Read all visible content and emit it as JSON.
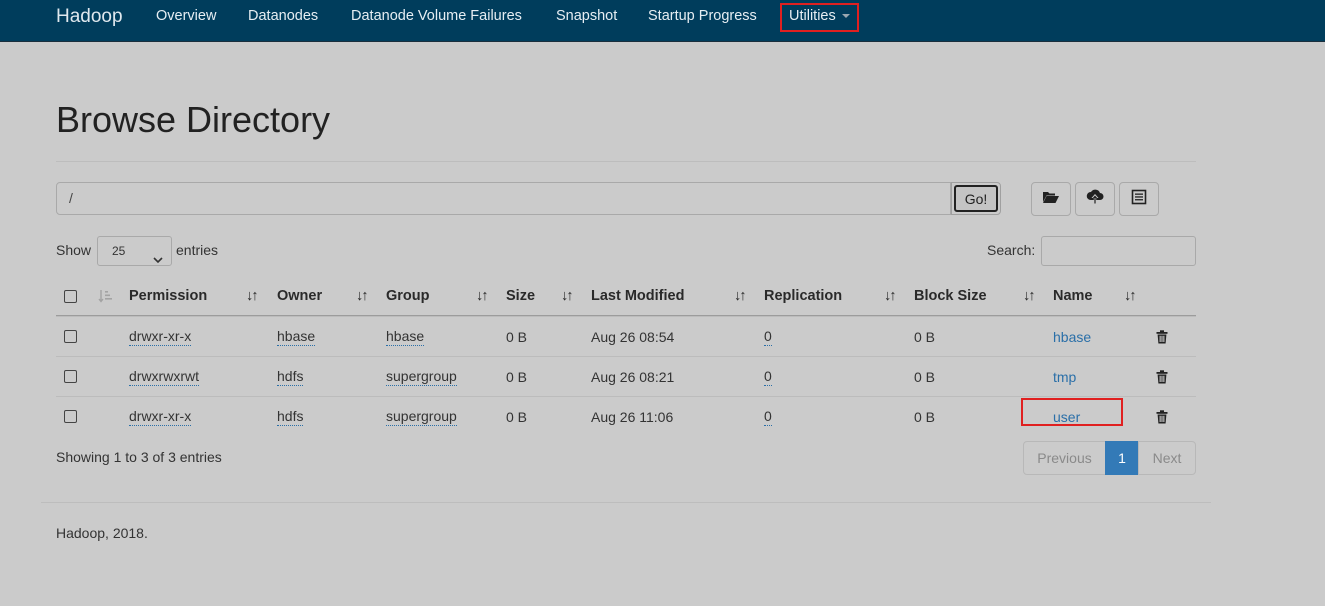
{
  "navbar": {
    "brand": "Hadoop",
    "items": [
      "Overview",
      "Datanodes",
      "Datanode Volume Failures",
      "Snapshot",
      "Startup Progress",
      "Utilities"
    ]
  },
  "page": {
    "title": "Browse Directory"
  },
  "path_bar": {
    "value": "/",
    "go_label": "Go!"
  },
  "toolbar": {
    "icons": [
      "folder-open-icon",
      "cloud-upload-icon",
      "list-alt-icon"
    ]
  },
  "length_control": {
    "show_label": "Show",
    "selected": "25",
    "entries_label": "entries"
  },
  "search": {
    "label": "Search:",
    "value": ""
  },
  "table": {
    "headers": [
      "Permission",
      "Owner",
      "Group",
      "Size",
      "Last Modified",
      "Replication",
      "Block Size",
      "Name"
    ],
    "rows": [
      {
        "permission": "drwxr-xr-x",
        "owner": "hbase",
        "group": "hbase",
        "size": "0 B",
        "modified": "Aug 26 08:54",
        "replication": "0",
        "block_size": "0 B",
        "name": "hbase"
      },
      {
        "permission": "drwxrwxrwt",
        "owner": "hdfs",
        "group": "supergroup",
        "size": "0 B",
        "modified": "Aug 26 08:21",
        "replication": "0",
        "block_size": "0 B",
        "name": "tmp"
      },
      {
        "permission": "drwxr-xr-x",
        "owner": "hdfs",
        "group": "supergroup",
        "size": "0 B",
        "modified": "Aug 26 11:06",
        "replication": "0",
        "block_size": "0 B",
        "name": "user"
      }
    ]
  },
  "info": "Showing 1 to 3 of 3 entries",
  "pagination": {
    "previous": "Previous",
    "current": "1",
    "next": "Next"
  },
  "footer": "Hadoop, 2018.",
  "colors": {
    "navbar": "#003d5c",
    "link": "#2a6fa8",
    "highlight": "#e02020",
    "active_page": "#337ab7"
  }
}
